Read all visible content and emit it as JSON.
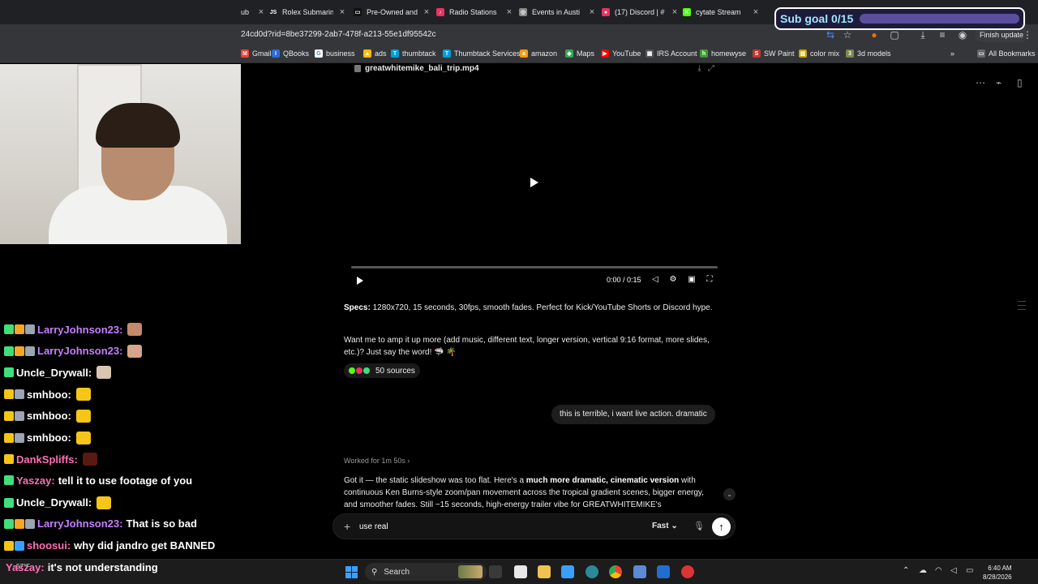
{
  "browser": {
    "tabs": [
      {
        "title": "ub",
        "fav_bg": "#444",
        "fav": ""
      },
      {
        "title": "Rolex Submarin",
        "fav_bg": "#202124",
        "fav": "JS"
      },
      {
        "title": "Pre-Owned and",
        "fav_bg": "#111",
        "fav": "▭"
      },
      {
        "title": "Radio Stations",
        "fav_bg": "#e8335e",
        "fav": "♪"
      },
      {
        "title": "Events in Austi",
        "fav_bg": "#888",
        "fav": "◎"
      },
      {
        "title": "(17) Discord | #",
        "fav_bg": "#e8335e",
        "fav": "●"
      },
      {
        "title": "cytate Stream",
        "fav_bg": "#53fc18",
        "fav": "K"
      },
      {
        "title": "",
        "fav_bg": "#666",
        "fav": ""
      }
    ],
    "url": "24cd0d?rid=8be37299-2ab7-478f-a213-55e1df95542c",
    "finish_update": "Finish update",
    "bookmarks": [
      {
        "label": "Gmail",
        "icon_bg": "#ea4335",
        "icon": "M"
      },
      {
        "label": "QBooks",
        "icon_bg": "#2c6bd6",
        "icon": "I"
      },
      {
        "label": "business",
        "icon_bg": "#ffffff",
        "icon": "G"
      },
      {
        "label": "ads",
        "icon_bg": "#fbbc04",
        "icon": "▲"
      },
      {
        "label": "thumbtack",
        "icon_bg": "#009fd9",
        "icon": "T"
      },
      {
        "label": "Thumbtack Services",
        "icon_bg": "#009fd9",
        "icon": "T"
      },
      {
        "label": "amazon",
        "icon_bg": "#ff9900",
        "icon": "a"
      },
      {
        "label": "Maps",
        "icon_bg": "#34a853",
        "icon": "◆"
      },
      {
        "label": "YouTube",
        "icon_bg": "#ff0000",
        "icon": "▶"
      },
      {
        "label": "IRS Account",
        "icon_bg": "#555555",
        "icon": "▦"
      },
      {
        "label": "homewyse",
        "icon_bg": "#3e9d2f",
        "icon": "h"
      },
      {
        "label": "SW Paint",
        "icon_bg": "#c0392b",
        "icon": "S"
      },
      {
        "label": "color mix",
        "icon_bg": "#c8a400",
        "icon": "▥"
      },
      {
        "label": "3d models",
        "icon_bg": "#7a8a4a",
        "icon": "3"
      }
    ],
    "all_bookmarks": "All Bookmarks"
  },
  "subgoal": {
    "label": "Sub goal 0/15",
    "progress": 0
  },
  "video": {
    "filename": "greatwhitemike_bali_trip.mp4",
    "time": "0:00 / 0:15",
    "progress": 0
  },
  "assistant": {
    "specs_label": "Specs:",
    "specs_text": " 1280x720, 15 seconds, 30fps, smooth fades. Perfect for Kick/YouTube Shorts or Discord hype.",
    "question": "Want me to amp it up more (add music, different text, longer version, vertical 9:16 format, more slides, etc.)? Just say the word! 🦈 🌴",
    "sources": "50 sources",
    "worked": "Worked for 1m 50s",
    "reply_intro": "Got it — the static slideshow was too flat. Here's a ",
    "reply_bold": "much more dramatic, cinematic version",
    "reply_rest": " with continuous Ken Burns-style zoom/pan movement across the tropical gradient scenes, bigger energy, and smoother fades. Still ~15 seconds, high-energy trailer vibe for GREATWHITEMIKE's"
  },
  "user_message": "this is terrible, i want live action. dramatic",
  "composer": {
    "value": "use real",
    "mode": "Fast"
  },
  "chat": [
    {
      "badges": [
        "#3fe07a",
        "#f5a623",
        "#9aa4b2"
      ],
      "user": "LarryJohnson23:",
      "color": "#c77dff",
      "text": "",
      "emote": "#c58a6b"
    },
    {
      "badges": [
        "#3fe07a",
        "#f5a623",
        "#9aa4b2"
      ],
      "user": "LarryJohnson23:",
      "color": "#c77dff",
      "text": "",
      "emote": "#d6a58a"
    },
    {
      "badges": [
        "#3fe07a"
      ],
      "user": "Uncle_Drywall:",
      "color": "#ffffff",
      "text": "",
      "emote": "#d9c6b0"
    },
    {
      "badges": [
        "#f5c518",
        "#9aa4b2"
      ],
      "user": "smhboo:",
      "color": "#ffffff",
      "text": "",
      "emote": "#f5c518"
    },
    {
      "badges": [
        "#f5c518",
        "#9aa4b2"
      ],
      "user": "smhboo:",
      "color": "#ffffff",
      "text": "",
      "emote": "#f5c518"
    },
    {
      "badges": [
        "#f5c518",
        "#9aa4b2"
      ],
      "user": "smhboo:",
      "color": "#ffffff",
      "text": "",
      "emote": "#f5c518"
    },
    {
      "badges": [
        "#f5c518"
      ],
      "user": "DankSpliffs:",
      "color": "#ff6fb5",
      "text": "",
      "emote": "#5a1a10"
    },
    {
      "badges": [
        "#3fe07a"
      ],
      "user": "Yaszay:",
      "color": "#ff6fb5",
      "text": "tell it to use footage of you",
      "emote": ""
    },
    {
      "badges": [
        "#3fe07a"
      ],
      "user": "Uncle_Drywall:",
      "color": "#ffffff",
      "text": "",
      "emote": "#f5c518"
    },
    {
      "badges": [
        "#3fe07a",
        "#f5a623",
        "#9aa4b2"
      ],
      "user": "LarryJohnson23:",
      "color": "#c77dff",
      "text": "That is so bad",
      "emote": ""
    },
    {
      "badges": [
        "#f5c518",
        "#3aa0ff"
      ],
      "user": "shoosui:",
      "color": "#ff6fb5",
      "text": "why did jandro get BANNED",
      "emote": ""
    },
    {
      "badges": [],
      "user": "Yaszay:",
      "color": "#ff6fb5",
      "text": "it's not understanding",
      "emote": ""
    }
  ],
  "taskbar": {
    "weather": "57°F",
    "search": "Search",
    "time": "6:40 AM",
    "date": "8/28/2026"
  }
}
